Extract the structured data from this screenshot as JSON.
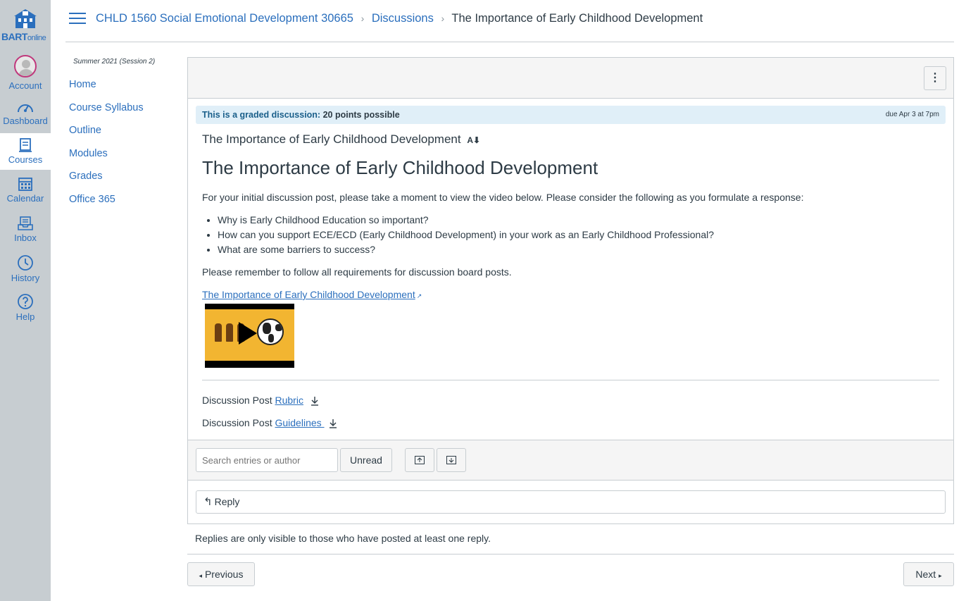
{
  "global_nav": {
    "logo_text": "BART",
    "logo_sub": "online",
    "items": [
      {
        "label": "Account",
        "icon": "avatar"
      },
      {
        "label": "Dashboard",
        "icon": "dashboard-icon"
      },
      {
        "label": "Courses",
        "icon": "courses-icon",
        "active": true
      },
      {
        "label": "Calendar",
        "icon": "calendar-icon"
      },
      {
        "label": "Inbox",
        "icon": "inbox-icon"
      },
      {
        "label": "History",
        "icon": "history-icon"
      },
      {
        "label": "Help",
        "icon": "help-icon"
      }
    ]
  },
  "breadcrumb": {
    "course": "CHLD 1560 Social Emotional Development 30665",
    "section": "Discussions",
    "current": "The Importance of Early Childhood Development",
    "separator": "›"
  },
  "course_nav": {
    "term": "Summer 2021 (Session 2)",
    "items": [
      "Home",
      "Course Syllabus",
      "Outline",
      "Modules",
      "Grades",
      "Office 365"
    ]
  },
  "discussion": {
    "menu_label": "⋮",
    "graded_label": "This is a graded discussion:",
    "points": "20 points possible",
    "due": "due Apr 3 at 7pm",
    "title_small": "The Importance of Early Childhood Development",
    "title_icon": "A",
    "heading": "The Importance of Early Childhood Development",
    "intro": "For your initial discussion post, please take a moment to view the video below.  Please consider the following as you formulate a response:",
    "bullets": [
      "Why is Early Childhood Education so important?",
      "How can you support ECE/ECD (Early Childhood Development) in your work as an Early Childhood Professional?",
      "What are some barriers to success?"
    ],
    "reminder": "Please remember to follow all requirements for discussion board posts.",
    "video_link": "The Importance of Early Childhood Development",
    "attachments": [
      {
        "prefix": "Discussion Post ",
        "link": "Rubric"
      },
      {
        "prefix": "Discussion Post ",
        "link": "Guidelines "
      }
    ]
  },
  "filter": {
    "search_placeholder": "Search entries or author",
    "unread_label": "Unread"
  },
  "reply": {
    "label": "Reply",
    "arrow": "↰"
  },
  "footer": {
    "note": "Replies are only visible to those who have posted at least one reply.",
    "previous": "Previous",
    "next": "Next",
    "prev_arrow": "◂",
    "next_arrow": "▸"
  },
  "colors": {
    "link": "#2b6fbd",
    "nav_bg": "#c7cdd1",
    "graded_bg": "#e0eff8"
  }
}
